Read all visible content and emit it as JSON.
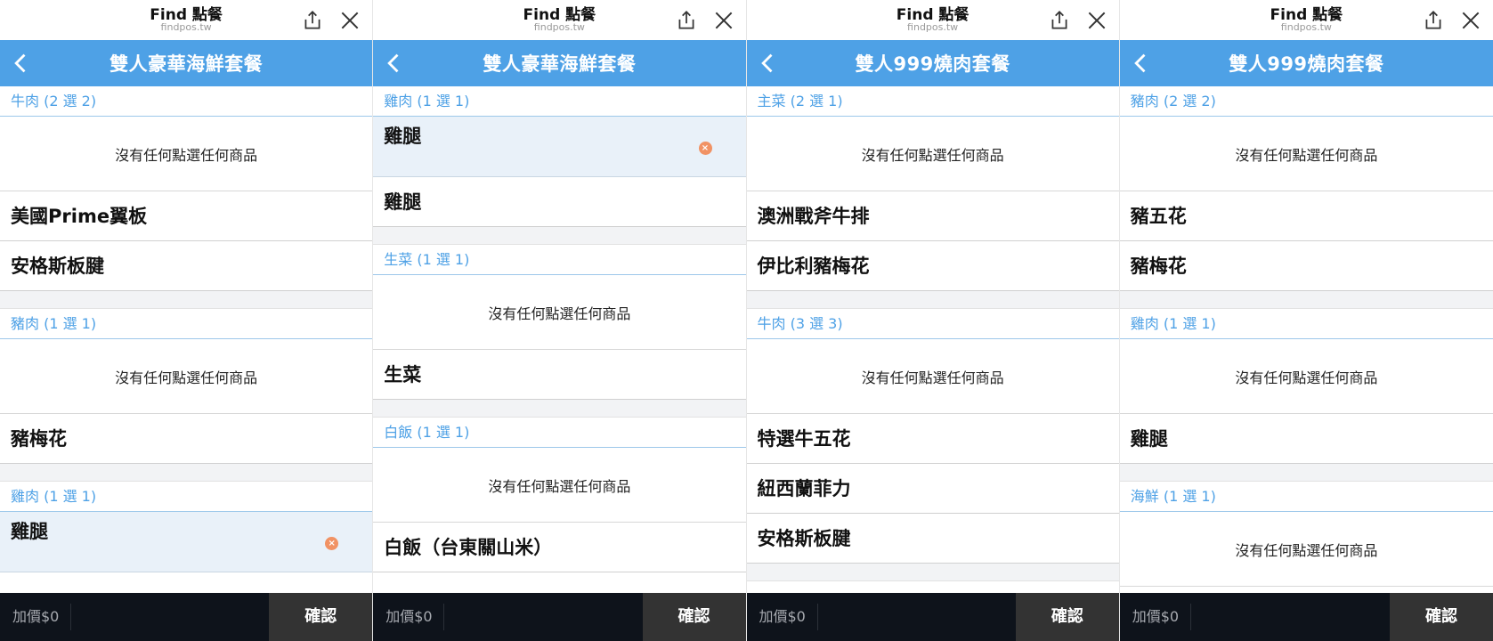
{
  "screens": [
    {
      "app_title": "Find 點餐",
      "app_url": "findpos.tw",
      "set_title": "雙人豪華海鮮套餐",
      "price_label": "加價$0",
      "confirm_label": "確認",
      "groups": [
        {
          "title": "牛肉 (2 選 2)",
          "empty_text": "沒有任何點選任何商品",
          "options": [
            "美國Prime翼板",
            "安格斯板腱"
          ]
        },
        {
          "title": "豬肉 (1 選 1)",
          "empty_text": "沒有任何點選任何商品",
          "options": [
            "豬梅花"
          ]
        },
        {
          "title": "雞肉 (1 選 1)",
          "selected": "雞腿",
          "options": []
        }
      ]
    },
    {
      "app_title": "Find 點餐",
      "app_url": "findpos.tw",
      "set_title": "雙人豪華海鮮套餐",
      "price_label": "加價$0",
      "confirm_label": "確認",
      "groups": [
        {
          "title": "雞肉 (1 選 1)",
          "selected": "雞腿",
          "options": [
            "雞腿"
          ]
        },
        {
          "title": "生菜 (1 選 1)",
          "empty_text": "沒有任何點選任何商品",
          "options": [
            "生菜"
          ]
        },
        {
          "title": "白飯 (1 選 1)",
          "empty_text": "沒有任何點選任何商品",
          "options": [
            "白飯（台東關山米）"
          ]
        }
      ]
    },
    {
      "app_title": "Find 點餐",
      "app_url": "findpos.tw",
      "set_title": "雙人999燒肉套餐",
      "price_label": "加價$0",
      "confirm_label": "確認",
      "groups": [
        {
          "title": "主菜 (2 選 1)",
          "empty_text": "沒有任何點選任何商品",
          "options": [
            "澳洲戰斧牛排",
            "伊比利豬梅花"
          ]
        },
        {
          "title": "牛肉 (3 選 3)",
          "empty_text": "沒有任何點選任何商品",
          "options": [
            "特選牛五花",
            "紐西蘭菲力",
            "安格斯板腱"
          ]
        }
      ]
    },
    {
      "app_title": "Find 點餐",
      "app_url": "findpos.tw",
      "set_title": "雙人999燒肉套餐",
      "price_label": "加價$0",
      "confirm_label": "確認",
      "groups": [
        {
          "title": "豬肉 (2 選 2)",
          "empty_text": "沒有任何點選任何商品",
          "options": [
            "豬五花",
            "豬梅花"
          ]
        },
        {
          "title": "雞肉 (1 選 1)",
          "empty_text": "沒有任何點選任何商品",
          "options": [
            "雞腿"
          ]
        },
        {
          "title": "海鮮 (1 選 1)",
          "empty_text": "沒有任何點選任何商品",
          "options": []
        }
      ]
    }
  ],
  "icons": {
    "share": "share-icon",
    "close": "close-icon",
    "back": "back-chevron-icon",
    "remove": "remove-selection-icon"
  },
  "colors": {
    "header_blue": "#4ea1e6",
    "group_title_blue": "#4ea1e6",
    "selected_bg": "#e9f1f9",
    "remove_orange": "#f19264",
    "footer_dark": "#0e131b",
    "confirm_bg": "#333333"
  }
}
